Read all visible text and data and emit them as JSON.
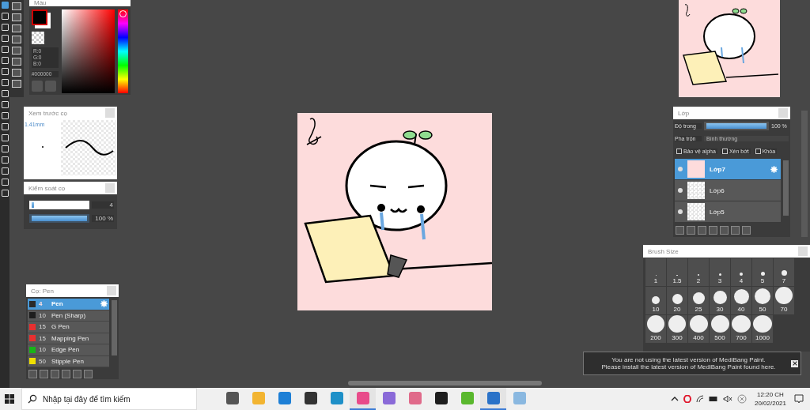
{
  "color_panel": {
    "title": "Màu",
    "rgb": [
      "R:0",
      "G:0",
      "B:0"
    ],
    "hex": "#000000"
  },
  "brush_preview": {
    "title": "Xem trước cọ",
    "size": "1.41mm"
  },
  "brush_control": {
    "title": "Kiểm soát cọ",
    "sliders": [
      {
        "level": 0.04,
        "reading": "4"
      },
      {
        "level": 1,
        "reading": "100 %"
      }
    ]
  },
  "brush_list": {
    "title": "Cọ: Pen",
    "items": [
      {
        "color": "#2a2a2a",
        "size": "4",
        "name": "Pen",
        "selected": true
      },
      {
        "color": "#1e1e1e",
        "size": "10",
        "name": "Pen (Sharp)",
        "selected": false
      },
      {
        "color": "#e83030",
        "size": "15",
        "name": "G Pen",
        "selected": false
      },
      {
        "color": "#e83030",
        "size": "15",
        "name": "Mapping Pen",
        "selected": false
      },
      {
        "color": "#18b418",
        "size": "10",
        "name": "Edge Pen",
        "selected": false
      },
      {
        "color": "#f0e000",
        "size": "50",
        "name": "Stipple Pen",
        "selected": false
      }
    ]
  },
  "layers": {
    "title": "Lớp",
    "opacity_label": "Độ trong",
    "opacity": {
      "level": 1,
      "reading": "100 %"
    },
    "blend_label": "Pha trộn",
    "blend": "Bình thường",
    "options": [
      {
        "label": "Bảo vệ alpha",
        "checked": false
      },
      {
        "label": "Xén bớt",
        "checked": false
      },
      {
        "label": "Khóa",
        "checked": false
      }
    ],
    "items": [
      {
        "name": "Lớp7",
        "selected": true,
        "visible": true
      },
      {
        "name": "Lớp6",
        "selected": false,
        "visible": true
      },
      {
        "name": "Lớp5",
        "selected": false,
        "visible": true
      }
    ]
  },
  "brush_size": {
    "title": "Brush Size",
    "sizes": [
      "1",
      "1.5",
      "2",
      "3",
      "4",
      "5",
      "7",
      "10",
      "20",
      "25",
      "30",
      "40",
      "50",
      "70",
      "200",
      "300",
      "400",
      "500",
      "700",
      "1000"
    ]
  },
  "notification": {
    "lines": [
      "You are not using the latest version of MediBang Paint.",
      "Please install the latest version of MediBang Paint found here."
    ]
  },
  "taskbar": {
    "search": {
      "placeholder": "Nhập tại đây để tìm kiếm"
    },
    "apps": [
      {
        "running": false
      },
      {
        "running": false
      },
      {
        "running": false
      },
      {
        "running": false
      },
      {
        "running": false
      },
      {
        "running": true
      },
      {
        "running": false
      },
      {
        "running": false
      },
      {
        "running": false
      },
      {
        "running": false
      },
      {
        "running": true
      },
      {
        "running": false
      }
    ],
    "time": "12:20 CH",
    "date": "20/02/2021"
  }
}
